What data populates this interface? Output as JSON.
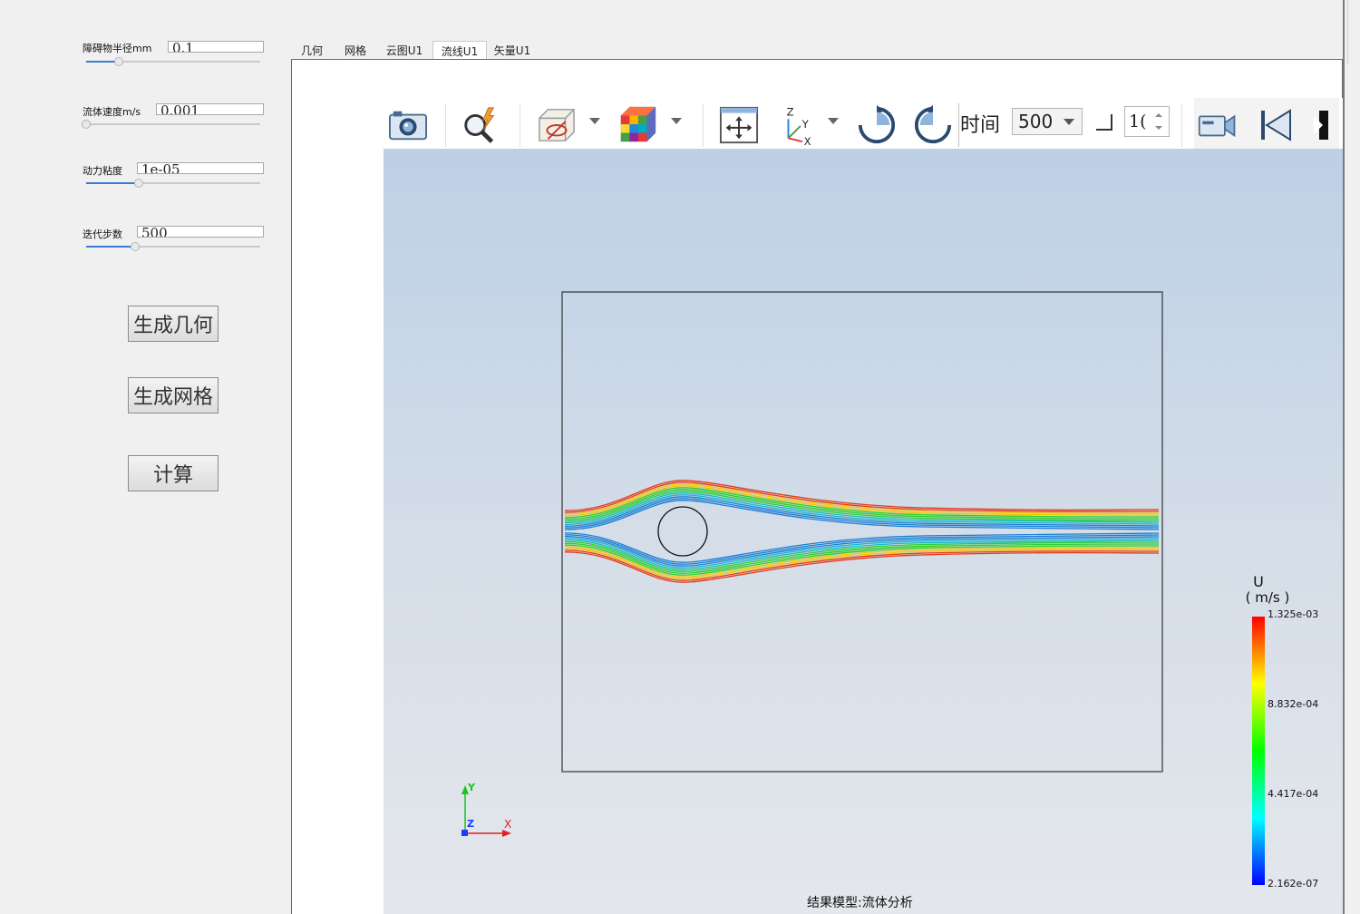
{
  "params": {
    "radius": {
      "label": "障碍物半径mm",
      "value": "0.1",
      "slider": 0.19
    },
    "velocity": {
      "label": "流体速度m/s",
      "value": "0.001",
      "slider": 0.0
    },
    "viscosity": {
      "label": "动力粘度",
      "value": "1e-05",
      "slider": 0.3
    },
    "steps": {
      "label": "迭代步数",
      "value": "500",
      "slider": 0.28
    }
  },
  "buttons": {
    "geometry": "生成几何",
    "mesh": "生成网格",
    "compute": "计算"
  },
  "tabs": [
    {
      "label": "几何",
      "active": false
    },
    {
      "label": "网格",
      "active": false
    },
    {
      "label": "云图U1",
      "active": false
    },
    {
      "label": "流线U1",
      "active": true
    },
    {
      "label": "矢量U1",
      "active": false
    }
  ],
  "toolbar": {
    "time_label": "时间",
    "time_value": "500",
    "spin_value": "1(",
    "icons": [
      "camera-icon",
      "quick-zoom-icon",
      "hide-show-icon",
      "color-cube-icon",
      "fit-view-icon",
      "axes-orient-icon",
      "rotate-cw-icon",
      "rotate-ccw-icon",
      "video-camera-icon",
      "first-frame-icon",
      "next-frame-icon"
    ]
  },
  "legend": {
    "title": "U",
    "unit": "( m/s )",
    "ticks": [
      "1.325e-03",
      "8.832e-04",
      "4.417e-04",
      "2.162e-07"
    ],
    "colors": [
      "#ff0000",
      "#ffff00",
      "#00ff00",
      "#00ffff",
      "#0000ff"
    ]
  },
  "axes": {
    "x": "X",
    "y": "Y",
    "z": "Z",
    "x_color": "#e02020",
    "y_color": "#20c020",
    "z_color": "#1a3cff"
  },
  "caption": "结果模型:流体分析"
}
